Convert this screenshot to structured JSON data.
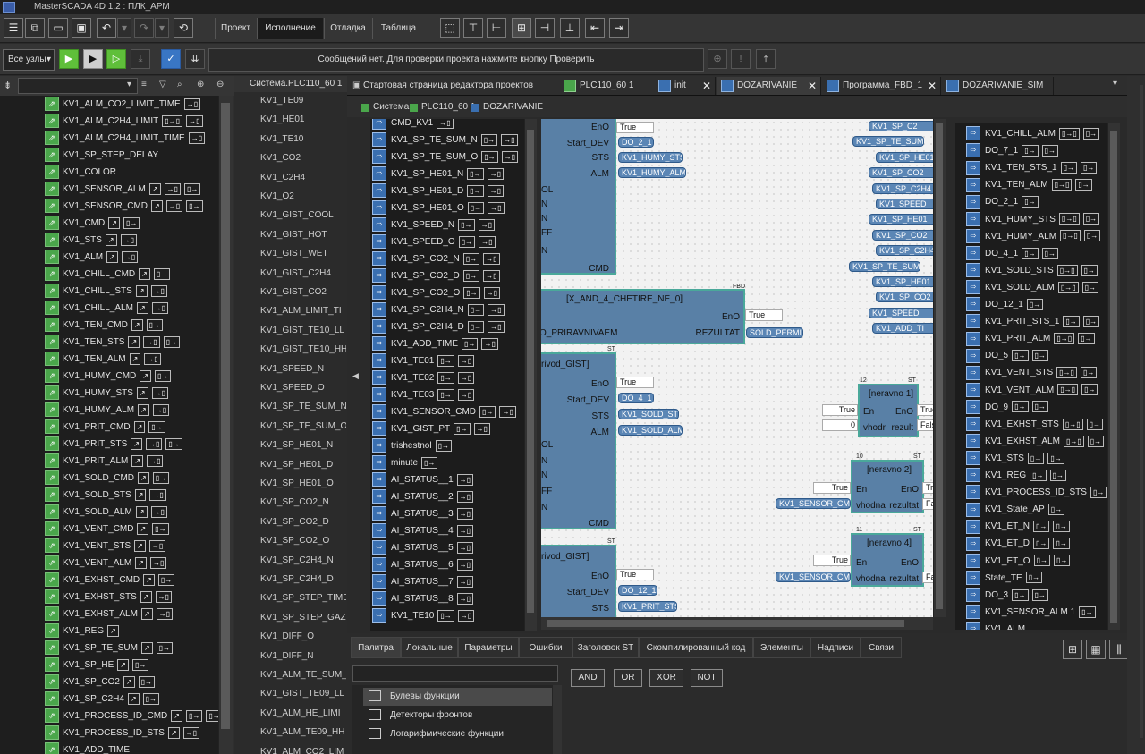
{
  "app": {
    "title": "MasterSCADA 4D 1.2 : ПЛК_АРМ"
  },
  "ribbon": {
    "tabs": [
      {
        "label": "Проект",
        "active": false
      },
      {
        "label": "Исполнение",
        "active": true
      },
      {
        "label": "Отладка",
        "active": false
      },
      {
        "label": "Таблица",
        "active": false
      }
    ],
    "nodes_select": "Все узлы",
    "message": "Сообщений нет. Для проверки проекта нажмите кнопку Проверить"
  },
  "left_panel": {
    "items": [
      {
        "label": "KV1_ALM_CO2_LIMIT_TIME",
        "links": [
          "→▯"
        ]
      },
      {
        "label": "KV1_ALM_C2H4_LIMIT",
        "links": [
          "▯→▯",
          "→▯"
        ]
      },
      {
        "label": "KV1_ALM_C2H4_LIMIT_TIME",
        "links": [
          "→▯"
        ]
      },
      {
        "label": "KV1_SP_STEP_DELAY",
        "links": []
      },
      {
        "label": "KV1_COLOR",
        "links": []
      },
      {
        "label": "KV1_SENSOR_ALM",
        "links": [
          "↗",
          "→▯",
          "▯→"
        ]
      },
      {
        "label": "KV1_SENSOR_CMD",
        "links": [
          "↗",
          "→▯",
          "▯→"
        ]
      },
      {
        "label": "KV1_CMD",
        "links": [
          "↗",
          "▯→"
        ]
      },
      {
        "label": "KV1_STS",
        "links": [
          "↗",
          "→▯"
        ]
      },
      {
        "label": "KV1_ALM",
        "links": [
          "↗",
          "→▯"
        ]
      },
      {
        "label": "KV1_CHILL_CMD",
        "links": [
          "↗",
          "▯→"
        ]
      },
      {
        "label": "KV1_CHILL_STS",
        "links": [
          "↗",
          "→▯"
        ]
      },
      {
        "label": "KV1_CHILL_ALM",
        "links": [
          "↗",
          "→▯"
        ]
      },
      {
        "label": "KV1_TEN_CMD",
        "links": [
          "↗",
          "▯→"
        ]
      },
      {
        "label": "KV1_TEN_STS",
        "links": [
          "↗",
          "→▯",
          "▯→"
        ]
      },
      {
        "label": "KV1_TEN_ALM",
        "links": [
          "↗",
          "→▯"
        ]
      },
      {
        "label": "KV1_HUMY_CMD",
        "links": [
          "↗",
          "▯→"
        ]
      },
      {
        "label": "KV1_HUMY_STS",
        "links": [
          "↗",
          "→▯"
        ]
      },
      {
        "label": "KV1_HUMY_ALM",
        "links": [
          "↗",
          "→▯"
        ]
      },
      {
        "label": "KV1_PRIT_CMD",
        "links": [
          "↗",
          "▯→"
        ]
      },
      {
        "label": "KV1_PRIT_STS",
        "links": [
          "↗",
          "→▯",
          "▯→"
        ]
      },
      {
        "label": "KV1_PRIT_ALM",
        "links": [
          "↗",
          "→▯"
        ]
      },
      {
        "label": "KV1_SOLD_CMD",
        "links": [
          "↗",
          "▯→"
        ]
      },
      {
        "label": "KV1_SOLD_STS",
        "links": [
          "↗",
          "→▯"
        ]
      },
      {
        "label": "KV1_SOLD_ALM",
        "links": [
          "↗",
          "→▯"
        ]
      },
      {
        "label": "KV1_VENT_CMD",
        "links": [
          "↗",
          "▯→"
        ]
      },
      {
        "label": "KV1_VENT_STS",
        "links": [
          "↗",
          "→▯"
        ]
      },
      {
        "label": "KV1_VENT_ALM",
        "links": [
          "↗",
          "→▯"
        ]
      },
      {
        "label": "KV1_EXHST_CMD",
        "links": [
          "↗",
          "▯→"
        ]
      },
      {
        "label": "KV1_EXHST_STS",
        "links": [
          "↗",
          "→▯"
        ]
      },
      {
        "label": "KV1_EXHST_ALM",
        "links": [
          "↗",
          "→▯"
        ]
      },
      {
        "label": "KV1_REG",
        "links": [
          "↗"
        ]
      },
      {
        "label": "KV1_SP_TE_SUM",
        "links": [
          "↗",
          "▯→"
        ]
      },
      {
        "label": "KV1_SP_HE",
        "links": [
          "↗",
          "▯→"
        ]
      },
      {
        "label": "KV1_SP_CO2",
        "links": [
          "↗",
          "▯→"
        ]
      },
      {
        "label": "KV1_SP_C2H4",
        "links": [
          "↗",
          "▯→"
        ]
      },
      {
        "label": "KV1_PROCESS_ID_CMD",
        "links": [
          "↗",
          "▯→",
          "▯→"
        ]
      },
      {
        "label": "KV1_PROCESS_ID_STS",
        "links": [
          "↗",
          "→▯"
        ]
      },
      {
        "label": "KV1_ADD_TIME",
        "links": []
      }
    ]
  },
  "col2": {
    "header": "Система.PLC110_60 1",
    "items": [
      "KV1_TE09",
      "KV1_HE01",
      "KV1_TE10",
      "KV1_CO2",
      "KV1_C2H4",
      "KV1_O2",
      "KV1_GIST_COOL",
      "KV1_GIST_HOT",
      "KV1_GIST_WET",
      "KV1_GIST_C2H4",
      "KV1_GIST_CO2",
      "KV1_ALM_LIMIT_TI",
      "KV1_GIST_TE10_LL",
      "KV1_GIST_TE10_HH",
      "KV1_SPEED_N",
      "KV1_SPEED_O",
      "KV1_SP_TE_SUM_N",
      "KV1_SP_TE_SUM_O",
      "KV1_SP_HE01_N",
      "KV1_SP_HE01_D",
      "KV1_SP_HE01_O",
      "KV1_SP_CO2_N",
      "KV1_SP_CO2_D",
      "KV1_SP_CO2_O",
      "KV1_SP_C2H4_N",
      "KV1_SP_C2H4_D",
      "KV1_SP_STEP_TIME",
      "KV1_SP_STEP_GAZ",
      "KV1_DIFF_O",
      "KV1_DIFF_N",
      "KV1_ALM_TE_SUM_",
      "KV1_GIST_TE09_LL",
      "KV1_ALM_HE_LIMI",
      "KV1_ALM_TE09_HH",
      "KV1_ALM_CO2_LIM"
    ]
  },
  "doc_tabs": [
    {
      "label": "Стартовая страница редактора проектов",
      "active": false,
      "closable": false
    },
    {
      "label": "PLC110_60 1",
      "active": false,
      "closable": false
    },
    {
      "label": "init",
      "active": false,
      "closable": true
    },
    {
      "label": "DOZARIVANIE",
      "active": true,
      "closable": true
    },
    {
      "label": "Программа_FBD_1",
      "active": false,
      "closable": true
    },
    {
      "label": "DOZARIVANIE_SIM",
      "active": false,
      "closable": false
    }
  ],
  "breadcrumb": [
    "Система",
    "PLC110_60 1",
    "DOZARIVANIE"
  ],
  "signals": [
    {
      "label": "CMD_KV1",
      "links": [
        "→▯"
      ]
    },
    {
      "label": "KV1_SP_TE_SUM_N",
      "links": [
        "▯→",
        "→▯"
      ]
    },
    {
      "label": "KV1_SP_TE_SUM_O",
      "links": [
        "▯→",
        "→▯"
      ]
    },
    {
      "label": "KV1_SP_HE01_N",
      "links": [
        "▯→",
        "→▯"
      ]
    },
    {
      "label": "KV1_SP_HE01_D",
      "links": [
        "▯→",
        "→▯"
      ]
    },
    {
      "label": "KV1_SP_HE01_O",
      "links": [
        "▯→",
        "→▯"
      ]
    },
    {
      "label": "KV1_SPEED_N",
      "links": [
        "▯→",
        "→▯"
      ]
    },
    {
      "label": "KV1_SPEED_O",
      "links": [
        "▯→",
        "→▯"
      ]
    },
    {
      "label": "KV1_SP_CO2_N",
      "links": [
        "▯→",
        "→▯"
      ]
    },
    {
      "label": "KV1_SP_CO2_D",
      "links": [
        "▯→",
        "→▯"
      ]
    },
    {
      "label": "KV1_SP_CO2_O",
      "links": [
        "▯→",
        "→▯"
      ]
    },
    {
      "label": "KV1_SP_C2H4_N",
      "links": [
        "▯→",
        "→▯"
      ]
    },
    {
      "label": "KV1_SP_C2H4_D",
      "links": [
        "▯→",
        "→▯"
      ]
    },
    {
      "label": "KV1_ADD_TIME",
      "links": [
        "▯→",
        "→▯"
      ]
    },
    {
      "label": "KV1_TE01",
      "links": [
        "▯→",
        "→▯"
      ]
    },
    {
      "label": "KV1_TE02",
      "links": [
        "▯→",
        "→▯"
      ]
    },
    {
      "label": "KV1_TE03",
      "links": [
        "▯→",
        "→▯"
      ]
    },
    {
      "label": "KV1_SENSOR_CMD",
      "links": [
        "▯→",
        "→▯"
      ]
    },
    {
      "label": "KV1_GIST_PT",
      "links": [
        "▯→",
        "→▯"
      ]
    },
    {
      "label": "trishestnol",
      "links": [
        "▯→"
      ]
    },
    {
      "label": "minute",
      "links": [
        "▯→"
      ]
    },
    {
      "label": "AI_STATUS__1",
      "links": [
        "→▯"
      ]
    },
    {
      "label": "AI_STATUS__2",
      "links": [
        "→▯"
      ]
    },
    {
      "label": "AI_STATUS__3",
      "links": [
        "→▯"
      ]
    },
    {
      "label": "AI_STATUS__4",
      "links": [
        "→▯"
      ]
    },
    {
      "label": "AI_STATUS__5",
      "links": [
        "→▯"
      ]
    },
    {
      "label": "AI_STATUS__6",
      "links": [
        "→▯"
      ]
    },
    {
      "label": "AI_STATUS__7",
      "links": [
        "→▯"
      ]
    },
    {
      "label": "AI_STATUS__8",
      "links": [
        "→▯"
      ]
    },
    {
      "label": "KV1_TE10",
      "links": [
        "▯→",
        "→▯"
      ]
    }
  ],
  "canvas": {
    "block1": {
      "pins_left": [
        "OL",
        "N",
        "N",
        "FF",
        "N"
      ],
      "outputs": [
        {
          "pin": "EnO",
          "value": "True"
        },
        {
          "pin": "Start_DEV",
          "sig": "DO_2_1"
        },
        {
          "pin": "STS",
          "sig": "KV1_HUMY_STS"
        },
        {
          "pin": "ALM",
          "sig": "KV1_HUMY_ALM"
        }
      ],
      "bottom_pin": "CMD"
    },
    "block2": {
      "title": "[X_AND_4_CHETIRE_NE_0]",
      "tag": "FBD",
      "left_text": "O_PRIRAVNIVAEM",
      "outputs": [
        {
          "pin": "EnO",
          "value": "True"
        },
        {
          "pin": "REZULTAT",
          "sig": "SOLD_PERMIT"
        }
      ]
    },
    "block3": {
      "title": "rivod_GIST]",
      "tag": "ST",
      "pins_left": [
        "OL",
        "N",
        "N",
        "FF",
        "N"
      ],
      "outputs": [
        {
          "pin": "EnO",
          "value": "True"
        },
        {
          "pin": "Start_DEV",
          "sig": "DO_4_1"
        },
        {
          "pin": "STS",
          "sig": "KV1_SOLD_STS"
        },
        {
          "pin": "ALM",
          "sig": "KV1_SOLD_ALM"
        }
      ],
      "bottom_pin": "CMD"
    },
    "block4": {
      "title": "rivod_GIST]",
      "tag": "ST",
      "outputs": [
        {
          "pin": "EnO",
          "value": "True"
        },
        {
          "pin": "Start_DEV",
          "sig": "DO_12_1"
        },
        {
          "pin": "STS",
          "sig": "KV1_PRIT_STS_1"
        }
      ]
    },
    "neravno1": {
      "title": "[neravno 1]",
      "num": "12",
      "tag": "ST",
      "in1": "En",
      "out1": "EnO",
      "in2": "vhodr",
      "out2": "rezult",
      "w1": "True",
      "w2": "0",
      "o1": "True",
      "o2": "False"
    },
    "neravno2": {
      "title": "[neravno 2]",
      "num": "10",
      "tag": "ST",
      "in1": "En",
      "out1": "EnO",
      "in2": "vhodna",
      "out2": "rezultat",
      "w1": "True",
      "sig": "KV1_SENSOR_CMD",
      "o1": "Tr",
      "o2": "Fa"
    },
    "neravno4": {
      "title": "[neravno 4]",
      "num": "11",
      "tag": "ST",
      "in1": "En",
      "out1": "EnO",
      "in2": "vhodna",
      "out2": "rezultat",
      "w1": "True",
      "sig": "KV1_SENSOR_CMD",
      "o2": "Fa"
    },
    "right_sigs": [
      "KV1_SP_C2",
      "KV1_SP_TE_SUM",
      "KV1_SP_HE01",
      "KV1_SP_CO2",
      "KV1_SP_C2H4",
      "KV1_SPEED",
      "KV1_SP_HE01",
      "KV1_SP_CO2",
      "KV1_SP_C2H4",
      "KV1_SP_TE_SUM",
      "KV1_SP_HE01",
      "KV1_SP_CO2",
      "KV1_SPEED",
      "KV1_ADD_TI"
    ]
  },
  "right_list": [
    {
      "label": "KV1_CHILL_ALM",
      "links": [
        "▯→▯",
        "▯→"
      ]
    },
    {
      "label": "DO_7_1",
      "links": [
        "▯→",
        "▯→"
      ]
    },
    {
      "label": "KV1_TEN_STS_1",
      "links": [
        "▯→",
        "▯→"
      ]
    },
    {
      "label": "KV1_TEN_ALM",
      "links": [
        "▯→▯",
        "▯→"
      ]
    },
    {
      "label": "DO_2_1",
      "links": [
        "▯→"
      ]
    },
    {
      "label": "KV1_HUMY_STS",
      "links": [
        "▯→▯",
        "▯→"
      ]
    },
    {
      "label": "KV1_HUMY_ALM",
      "links": [
        "▯→▯",
        "▯→"
      ]
    },
    {
      "label": "DO_4_1",
      "links": [
        "▯→",
        "▯→"
      ]
    },
    {
      "label": "KV1_SOLD_STS",
      "links": [
        "▯→▯",
        "▯→"
      ]
    },
    {
      "label": "KV1_SOLD_ALM",
      "links": [
        "▯→▯",
        "▯→"
      ]
    },
    {
      "label": "DO_12_1",
      "links": [
        "▯→"
      ]
    },
    {
      "label": "KV1_PRIT_STS_1",
      "links": [
        "▯→",
        "▯→"
      ]
    },
    {
      "label": "KV1_PRIT_ALM",
      "links": [
        "▯→▯",
        "▯→"
      ]
    },
    {
      "label": "DO_5",
      "links": [
        "▯→",
        "▯→"
      ]
    },
    {
      "label": "KV1_VENT_STS",
      "links": [
        "▯→▯",
        "▯→"
      ]
    },
    {
      "label": "KV1_VENT_ALM",
      "links": [
        "▯→▯",
        "▯→"
      ]
    },
    {
      "label": "DO_9",
      "links": [
        "▯→",
        "▯→"
      ]
    },
    {
      "label": "KV1_EXHST_STS",
      "links": [
        "▯→▯",
        "▯→"
      ]
    },
    {
      "label": "KV1_EXHST_ALM",
      "links": [
        "▯→▯",
        "▯→"
      ]
    },
    {
      "label": "KV1_STS",
      "links": [
        "▯→",
        "▯→"
      ]
    },
    {
      "label": "KV1_REG",
      "links": [
        "▯→",
        "▯→"
      ]
    },
    {
      "label": "KV1_PROCESS_ID_STS",
      "links": [
        "▯→",
        "▯→"
      ]
    },
    {
      "label": "KV1_State_AP",
      "links": [
        "▯→"
      ]
    },
    {
      "label": "KV1_ET_N",
      "links": [
        "▯→",
        "▯→"
      ]
    },
    {
      "label": "KV1_ET_D",
      "links": [
        "▯→",
        "▯→"
      ]
    },
    {
      "label": "KV1_ET_O",
      "links": [
        "▯→",
        "▯→"
      ]
    },
    {
      "label": "State_TE",
      "links": [
        "▯→"
      ]
    },
    {
      "label": "DO_3",
      "links": [
        "▯→",
        "▯→"
      ]
    },
    {
      "label": "KV1_SENSOR_ALM 1",
      "links": [
        "▯→"
      ]
    },
    {
      "label": "KV1_ALM",
      "links": []
    }
  ],
  "bottom": {
    "tabs": [
      "Палитра",
      "Локальные",
      "Параметры",
      "Ошибки",
      "Заголовок ST",
      "Скомпилированный код",
      "Элементы",
      "Надписи",
      "Связи"
    ],
    "palette": [
      "Булевы функции",
      "Детекторы фронтов",
      "Логарифмические функции"
    ],
    "logic_buttons": [
      "AND",
      "OR",
      "XOR",
      "NOT"
    ]
  },
  "colors": {
    "accent_blue": "#3a6fb0",
    "block_fill": "#5980a6",
    "block_border": "#4aa89a",
    "tree_green": "#4aa64b",
    "run_green": "#5fbf3a"
  }
}
